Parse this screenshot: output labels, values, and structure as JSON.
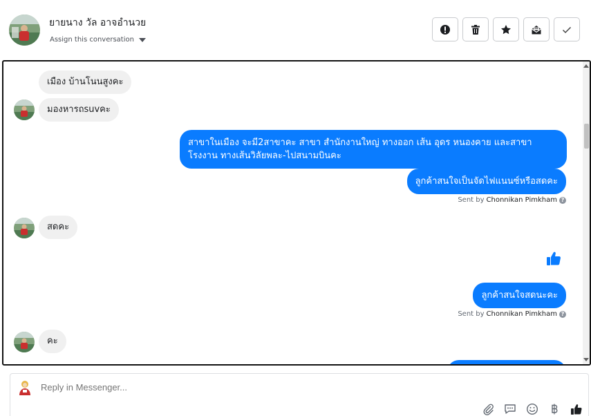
{
  "header": {
    "contact_name": "ยายนาง วัล อาจอำนวย",
    "assign_label": "Assign this conversation",
    "actions": [
      {
        "name": "mark-spam-button",
        "icon": "alert-icon"
      },
      {
        "name": "delete-button",
        "icon": "trash-icon"
      },
      {
        "name": "star-button",
        "icon": "star-icon"
      },
      {
        "name": "mark-unread-button",
        "icon": "envelope-icon"
      },
      {
        "name": "done-button",
        "icon": "check-icon"
      }
    ]
  },
  "messages": [
    {
      "direction": "in",
      "text": "เมือง   บ้านโนนสูงคะ"
    },
    {
      "direction": "in",
      "text": "มองหารถsuvคะ"
    },
    {
      "direction": "out",
      "text": "สาขาในเมือง จะมี2สาขาคะ สาขา สำนักงานใหญ่ ทางออก เส้น อุดร หนองคาย และสาขาโรงงาน ทางเส้นวิลัยพละ-ไปสนามบินคะ"
    },
    {
      "direction": "out",
      "text": "ลูกค้าสนใจเป็นจัดไฟแนนซ์หรือสดคะ"
    },
    {
      "direction": "in",
      "text": "สดคะ"
    },
    {
      "direction": "out",
      "icon": "thumbs-up-icon"
    },
    {
      "direction": "out",
      "text": "ลูกค้าสนใจสดนะคะ"
    },
    {
      "direction": "in",
      "text": "คะ"
    }
  ],
  "sent_by": {
    "prefix": "Sent by",
    "agent": "Chonnikan Pimkham",
    "help": "?"
  },
  "reply": {
    "placeholder": "Reply in Messenger...",
    "tools": [
      "attach-icon",
      "quick-reply-icon",
      "emoji-icon",
      "baht-icon",
      "thumbs-up-icon"
    ]
  },
  "colors": {
    "outgoing_bubble": "#0a7cff",
    "incoming_bubble": "#f0f0f0",
    "accent": "#0a7cff"
  }
}
